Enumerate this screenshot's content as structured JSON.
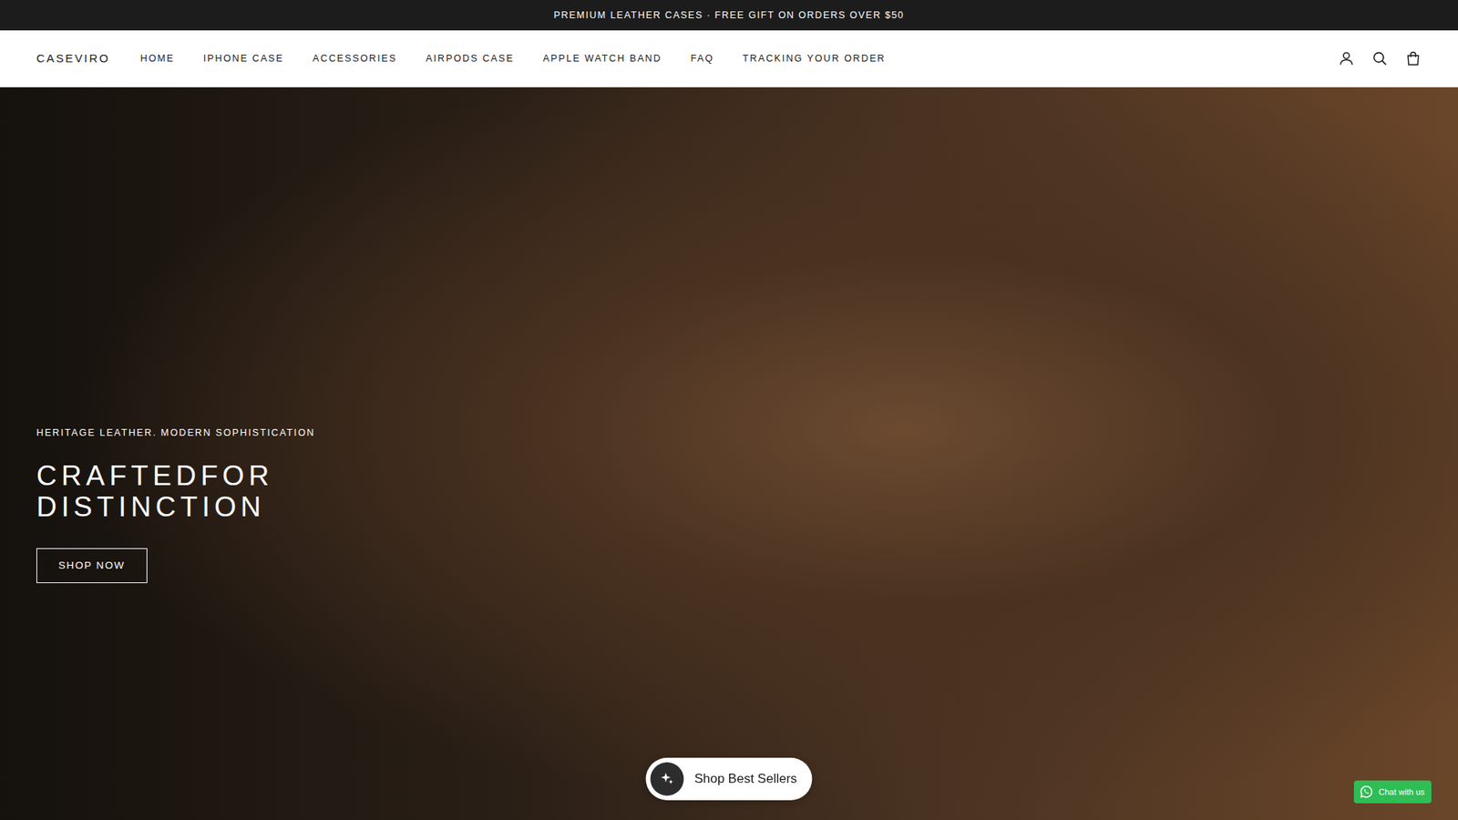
{
  "announcement": "PREMIUM LEATHER CASES · FREE GIFT ON ORDERS OVER $50",
  "header": {
    "logo": "CASEVIRO",
    "nav": [
      {
        "label": "HOME"
      },
      {
        "label": "IPHONE CASE"
      },
      {
        "label": "ACCESSORIES"
      },
      {
        "label": "AIRPODS CASE"
      },
      {
        "label": "APPLE WATCH BAND"
      },
      {
        "label": "FAQ"
      },
      {
        "label": "TRACKING YOUR ORDER"
      }
    ]
  },
  "hero": {
    "eyebrow": "HERITAGE LEATHER. MODERN SOPHISTICATION",
    "title_lines": [
      "CRAFTEDFOR",
      "DISTINCTION"
    ],
    "button": "SHOP NOW"
  },
  "floating": {
    "label": "Shop Best Sellers"
  },
  "chat": {
    "label": "Chat with us"
  }
}
